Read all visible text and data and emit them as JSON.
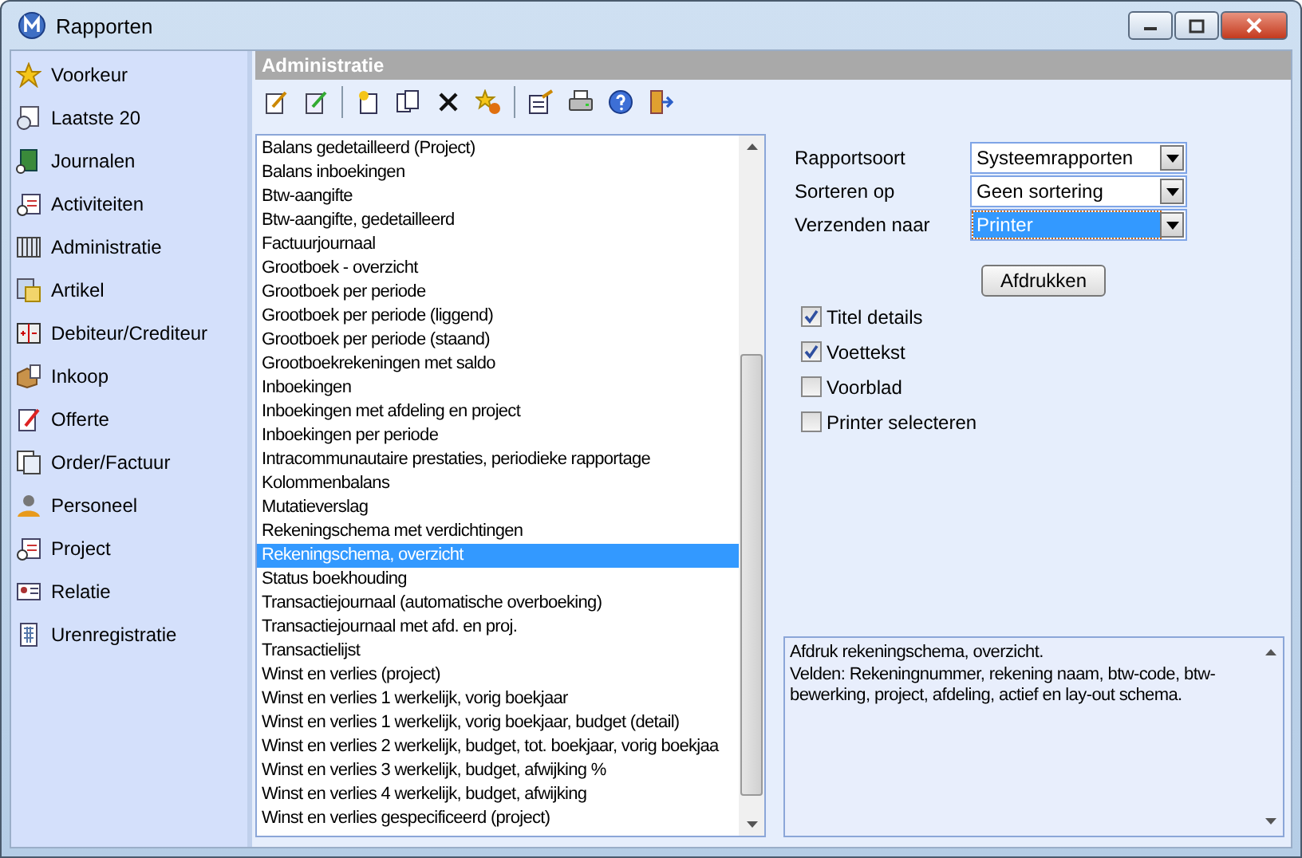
{
  "window": {
    "title": "Rapporten"
  },
  "sidebar": {
    "items": [
      {
        "label": "Voorkeur",
        "kind": "star"
      },
      {
        "label": "Laatste 20",
        "kind": "clock"
      },
      {
        "label": "Journalen",
        "kind": "book"
      },
      {
        "label": "Activiteiten",
        "kind": "list"
      },
      {
        "label": "Administratie",
        "kind": "columns"
      },
      {
        "label": "Artikel",
        "kind": "cards"
      },
      {
        "label": "Debiteur/Crediteur",
        "kind": "grid"
      },
      {
        "label": "Inkoop",
        "kind": "box"
      },
      {
        "label": "Offerte",
        "kind": "pen"
      },
      {
        "label": "Order/Factuur",
        "kind": "pages"
      },
      {
        "label": "Personeel",
        "kind": "person"
      },
      {
        "label": "Project",
        "kind": "list"
      },
      {
        "label": "Relatie",
        "kind": "card"
      },
      {
        "label": "Urenregistratie",
        "kind": "sheet"
      }
    ]
  },
  "panel": {
    "title": "Administratie"
  },
  "reports": [
    {
      "label": "Balans gedetailleerd (Project)",
      "selected": false
    },
    {
      "label": "Balans inboekingen",
      "selected": false
    },
    {
      "label": "Btw-aangifte",
      "selected": false
    },
    {
      "label": "Btw-aangifte, gedetailleerd",
      "selected": false
    },
    {
      "label": "Factuurjournaal",
      "selected": false
    },
    {
      "label": "Grootboek - overzicht",
      "selected": false
    },
    {
      "label": "Grootboek per periode",
      "selected": false
    },
    {
      "label": "Grootboek per periode (liggend)",
      "selected": false
    },
    {
      "label": "Grootboek per periode (staand)",
      "selected": false
    },
    {
      "label": "Grootboekrekeningen met saldo",
      "selected": false
    },
    {
      "label": "Inboekingen",
      "selected": false
    },
    {
      "label": "Inboekingen met afdeling en project",
      "selected": false
    },
    {
      "label": "Inboekingen per periode",
      "selected": false
    },
    {
      "label": "Intracommunautaire prestaties, periodieke rapportage",
      "selected": false
    },
    {
      "label": "Kolommenbalans",
      "selected": false
    },
    {
      "label": "Mutatieverslag",
      "selected": false
    },
    {
      "label": "Rekeningschema met verdichtingen",
      "selected": false
    },
    {
      "label": "Rekeningschema, overzicht",
      "selected": true
    },
    {
      "label": "Status boekhouding",
      "selected": false
    },
    {
      "label": "Transactiejournaal (automatische overboeking)",
      "selected": false
    },
    {
      "label": "Transactiejournaal met afd. en proj.",
      "selected": false
    },
    {
      "label": "Transactielijst",
      "selected": false
    },
    {
      "label": "Winst en verlies (project)",
      "selected": false
    },
    {
      "label": "Winst en verlies 1 werkelijk, vorig boekjaar",
      "selected": false
    },
    {
      "label": "Winst en verlies 1 werkelijk, vorig boekjaar, budget (detail)",
      "selected": false
    },
    {
      "label": "Winst en verlies 2 werkelijk, budget, tot. boekjaar, vorig boekjaa",
      "selected": false
    },
    {
      "label": "Winst en verlies 3 werkelijk, budget, afwijking %",
      "selected": false
    },
    {
      "label": "Winst en verlies 4 werkelijk, budget, afwijking",
      "selected": false
    },
    {
      "label": "Winst en verlies gespecificeerd (project)",
      "selected": false
    }
  ],
  "fields": [
    {
      "label": "Rapportsoort",
      "value": "Systeemrapporten",
      "focused": false
    },
    {
      "label": "Sorteren op",
      "value": "Geen sortering",
      "focused": false
    },
    {
      "label": "Verzenden naar",
      "value": "Printer",
      "focused": true
    }
  ],
  "print_button": "Afdrukken",
  "options": [
    {
      "label": "Titel details",
      "checked": true
    },
    {
      "label": "Voettekst",
      "checked": true
    },
    {
      "label": "Voorblad",
      "checked": false
    },
    {
      "label": "Printer selecteren",
      "checked": false
    }
  ],
  "description": [
    "Afdruk rekeningschema, overzicht.",
    "Velden: Rekeningnummer, rekening naam, btw-code, btw-bewerking, project, afdeling, actief en lay-out schema."
  ]
}
